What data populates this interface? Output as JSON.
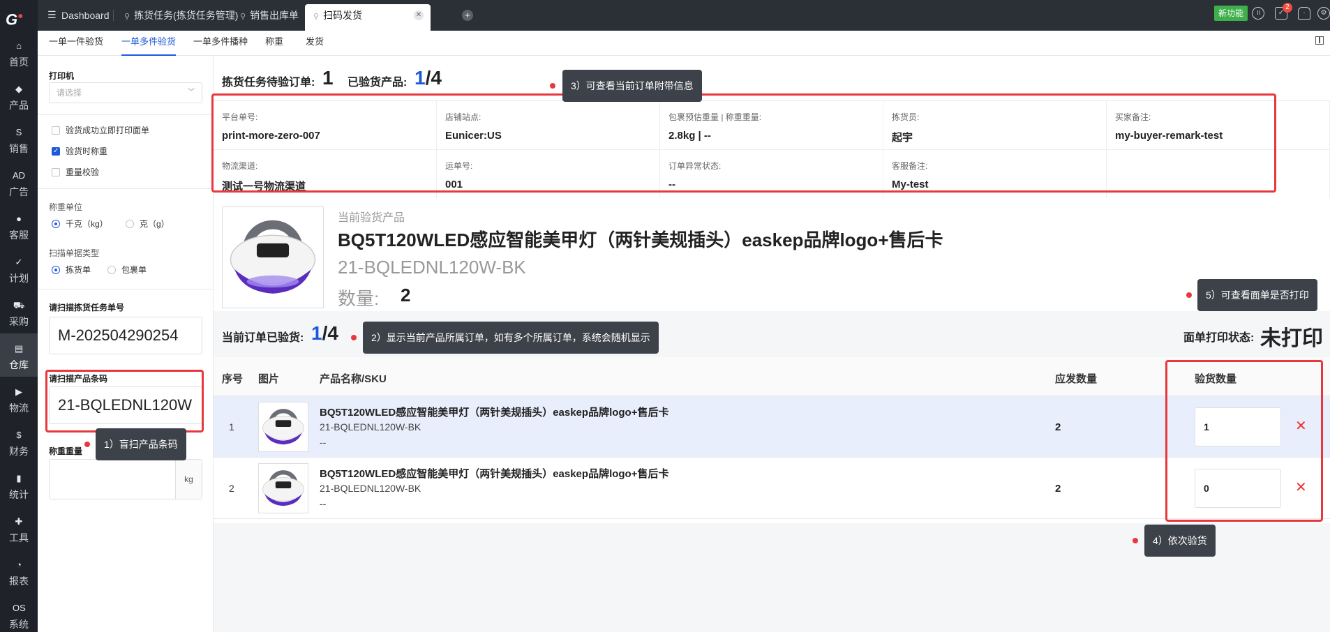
{
  "nav": {
    "logo": "G",
    "items": [
      {
        "label": "首页",
        "icon": "home-icon",
        "glyph": "⌂"
      },
      {
        "label": "产品",
        "icon": "cube-icon",
        "glyph": "◆"
      },
      {
        "label": "销售",
        "icon": "sales-icon",
        "glyph": "S"
      },
      {
        "label": "广告",
        "icon": "ad-icon",
        "glyph": "AD"
      },
      {
        "label": "客服",
        "icon": "chat-icon",
        "glyph": "●"
      },
      {
        "label": "计划",
        "icon": "clipboard-icon",
        "glyph": "✓"
      },
      {
        "label": "采购",
        "icon": "cart-icon",
        "glyph": "⛟"
      },
      {
        "label": "仓库",
        "icon": "warehouse-icon",
        "glyph": "▤"
      },
      {
        "label": "物流",
        "icon": "truck-icon",
        "glyph": "▶"
      },
      {
        "label": "财务",
        "icon": "money-bag-icon",
        "glyph": "$"
      },
      {
        "label": "统计",
        "icon": "stats-icon",
        "glyph": "▮"
      },
      {
        "label": "工具",
        "icon": "toolbox-icon",
        "glyph": "✚"
      },
      {
        "label": "报表",
        "icon": "pie-chart-icon",
        "glyph": "◔"
      },
      {
        "label": "系统",
        "icon": "os-icon",
        "glyph": "OS"
      }
    ],
    "active_index": 7
  },
  "tabs": {
    "items": [
      "Dashboard",
      "拣货任务(拣货任务管理)",
      "销售出库单",
      "扫码发货"
    ],
    "active_index": 3
  },
  "topbar": {
    "new_feature": "新功能",
    "notification_count": "2"
  },
  "subtabs": {
    "items": [
      "一单一件验货",
      "一单多件验货",
      "一单多件播种",
      "称重",
      "发货"
    ],
    "active_index": 1
  },
  "config": {
    "printer_label": "打印机",
    "printer_placeholder": "请选择",
    "checks": [
      {
        "label": "验货成功立即打印面单",
        "checked": false
      },
      {
        "label": "验货时称重",
        "checked": true
      },
      {
        "label": "重量校验",
        "checked": false
      }
    ],
    "weight_unit_label": "称重单位",
    "weight_units": [
      "千克（kg）",
      "克（g）"
    ],
    "scan_type_label": "扫描单据类型",
    "scan_types": [
      "拣货单",
      "包裹单"
    ],
    "task_no_label": "请扫描拣货任务单号",
    "task_no_value": "M-202504290254",
    "barcode_label": "请扫描产品条码",
    "barcode_value": "21-BQLEDNL120W",
    "weigh_label": "称重重量",
    "weigh_unit": "kg"
  },
  "summary": {
    "pending_label": "拣货任务待验订单:",
    "pending_value": "1",
    "verified_label": "已验货产品:",
    "verified_done": "1",
    "verified_total": "/4"
  },
  "order_info": [
    {
      "key": "平台单号:",
      "value": "print-more-zero-007"
    },
    {
      "key": "店铺站点:",
      "value": "Eunicer:US"
    },
    {
      "key": "包裹预估重量 | 称重重量:",
      "value": "2.8kg | --"
    },
    {
      "key": "拣货员:",
      "value": "起宇"
    },
    {
      "key": "买家备注:",
      "value": "my-buyer-remark-test"
    },
    {
      "key": "物流渠道:",
      "value": "测试一号物流渠道"
    },
    {
      "key": "运单号:",
      "value": "001"
    },
    {
      "key": "订单异常状态:",
      "value": "--"
    },
    {
      "key": "客服备注:",
      "value": "My-test"
    },
    {
      "key": "",
      "value": ""
    }
  ],
  "current_product": {
    "label": "当前验货产品",
    "name": "BQ5T120WLED感应智能美甲灯（两针美规插头）easkep品牌logo+售后卡",
    "sku": "21-BQLEDNL120W-BK",
    "qty_label": "数量:",
    "qty_value": "2"
  },
  "order_status": {
    "verified_label": "当前订单已验货:",
    "verified_done": "1",
    "verified_total": "/4",
    "print_label": "面单打印状态:",
    "print_value": "未打印"
  },
  "table": {
    "headers": [
      "序号",
      "图片",
      "产品名称/SKU",
      "应发数量",
      "验货数量"
    ],
    "rows": [
      {
        "idx": "1",
        "name": "BQ5T120WLED感应智能美甲灯（两针美规插头）easkep品牌logo+售后卡",
        "sku": "21-BQLEDNL120W-BK",
        "dash": "--",
        "ship_qty": "2",
        "check_qty": "1",
        "highlighted": true
      },
      {
        "idx": "2",
        "name": "BQ5T120WLED感应智能美甲灯（两针美规插头）easkep品牌logo+售后卡",
        "sku": "21-BQLEDNL120W-BK",
        "dash": "--",
        "ship_qty": "2",
        "check_qty": "0",
        "highlighted": false
      }
    ]
  },
  "annotations": {
    "tip1": "1）盲扫产品条码",
    "tip2": "2）显示当前产品所属订单，如有多个所属订单，系统会随机显示",
    "tip3": "3）可查看当前订单附带信息",
    "tip4": "4）依次验货",
    "tip5": "5）可查看面单是否打印"
  },
  "colors": {
    "accent": "#1f5ad6",
    "annotation_red": "#e8383d",
    "nav_bg": "#1f2329"
  }
}
